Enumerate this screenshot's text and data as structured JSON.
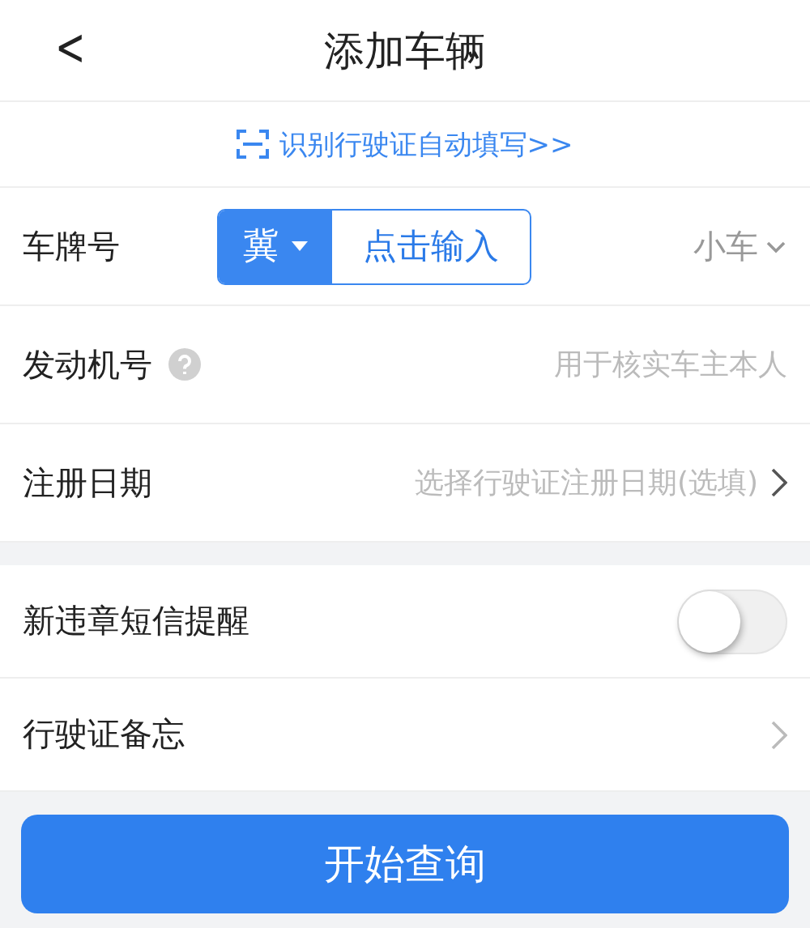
{
  "header": {
    "back": "<",
    "title": "添加车辆"
  },
  "scan_link": "识别行驶证自动填写>>",
  "form_rows": [
    {
      "kind": "plate",
      "label": "车牌号",
      "province": "冀",
      "plate_placeholder": "点击输入",
      "vehicle_type": "小车"
    },
    {
      "kind": "input",
      "label": "发动机号",
      "help": true,
      "placeholder": "用于核实车主本人"
    },
    {
      "kind": "picker",
      "label": "注册日期",
      "placeholder": "选择行驶证注册日期(选填)"
    }
  ],
  "settings_rows": [
    {
      "kind": "toggle",
      "label": "新违章短信提醒",
      "on": false
    },
    {
      "kind": "link",
      "label": "行驶证备忘"
    }
  ],
  "submit_button": "开始查询"
}
